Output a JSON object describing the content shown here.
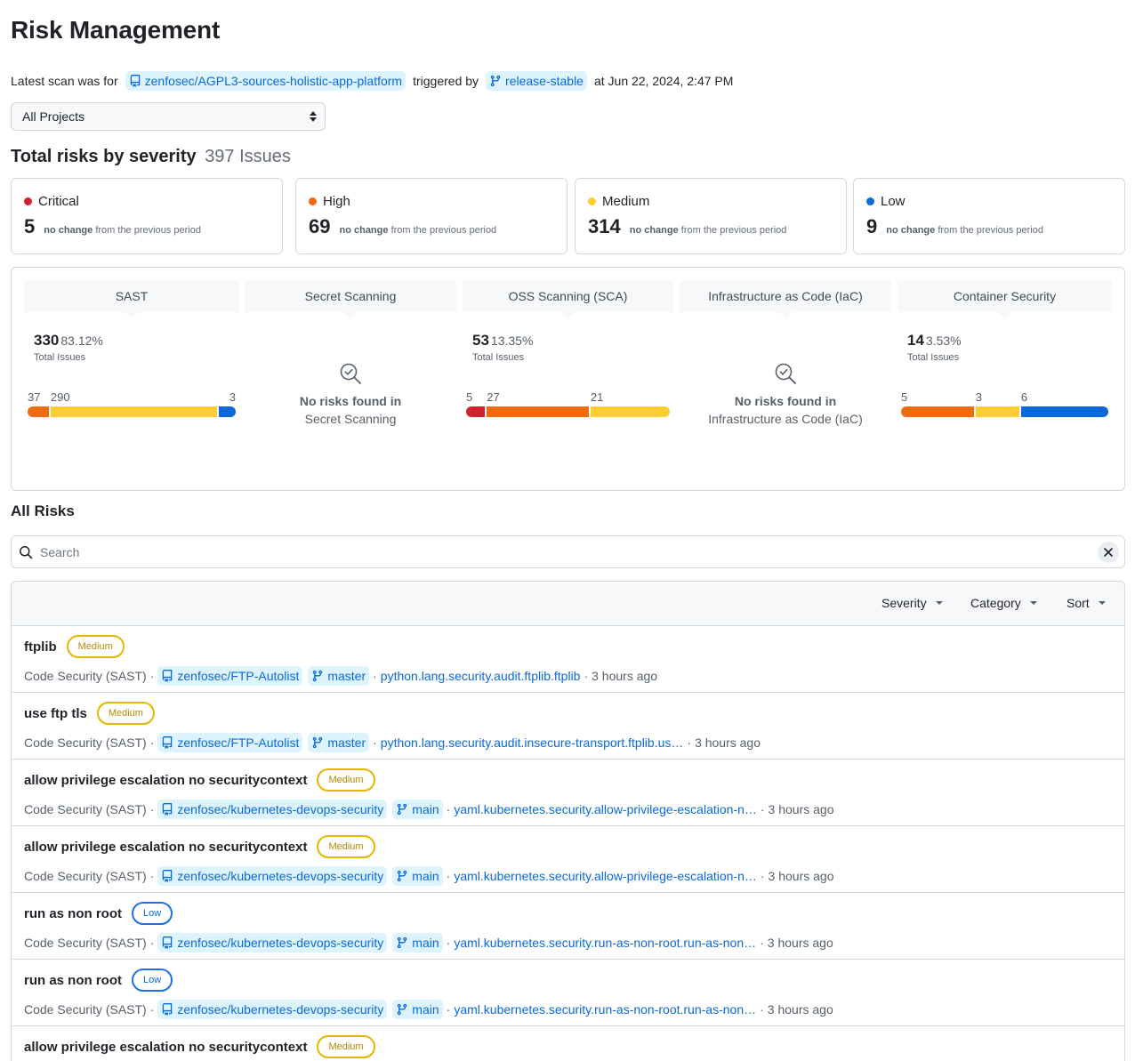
{
  "header": {
    "title": "Risk Management",
    "scan_prefix": "Latest scan was for",
    "repo": "zenfosec/AGPL3-sources-holistic-app-platform",
    "triggered_by": "triggered by",
    "branch": "release-stable",
    "at_text": "at Jun 22, 2024, 2:47 PM"
  },
  "project_select": {
    "value": "All Projects"
  },
  "severity_summary": {
    "title": "Total risks by severity",
    "count": "397 Issues",
    "cards": [
      {
        "label": "Critical",
        "value": "5",
        "change": "no change",
        "suffix": "from the previous period",
        "color": "#cf222e"
      },
      {
        "label": "High",
        "value": "69",
        "change": "no change",
        "suffix": "from the previous period",
        "color": "#f06a0f"
      },
      {
        "label": "Medium",
        "value": "314",
        "change": "no change",
        "suffix": "from the previous period",
        "color": "#fdcd33"
      },
      {
        "label": "Low",
        "value": "9",
        "change": "no change",
        "suffix": "from the previous period",
        "color": "#0969da"
      }
    ]
  },
  "categories": [
    {
      "name": "SAST",
      "total": "330",
      "percent": "83.12%",
      "sub": "Total Issues",
      "segments": [
        {
          "label": "37",
          "value": 37,
          "color": "#f06a0f"
        },
        {
          "label": "290",
          "value": 290,
          "color": "#fdcd33"
        },
        {
          "label": "3",
          "value": 3,
          "color": "#0969da"
        }
      ]
    },
    {
      "name": "Secret Scanning",
      "empty_title": "No risks found in",
      "empty_sub": "Secret Scanning"
    },
    {
      "name": "OSS Scanning (SCA)",
      "total": "53",
      "percent": "13.35%",
      "sub": "Total Issues",
      "segments": [
        {
          "label": "5",
          "value": 5,
          "color": "#cf222e"
        },
        {
          "label": "27",
          "value": 27,
          "color": "#f06a0f"
        },
        {
          "label": "21",
          "value": 21,
          "color": "#fdcd33"
        }
      ]
    },
    {
      "name": "Infrastructure as Code (IaC)",
      "empty_title": "No risks found in",
      "empty_sub": "Infrastructure as Code (IaC)"
    },
    {
      "name": "Container Security",
      "total": "14",
      "percent": "3.53%",
      "sub": "Total Issues",
      "segments": [
        {
          "label": "5",
          "value": 5,
          "color": "#f06a0f"
        },
        {
          "label": "3",
          "value": 3,
          "color": "#fdcd33"
        },
        {
          "label": "6",
          "value": 6,
          "color": "#0969da"
        }
      ]
    }
  ],
  "all_risks": {
    "title": "All Risks",
    "search_placeholder": "Search",
    "filters": {
      "severity": "Severity",
      "category": "Category",
      "sort": "Sort"
    },
    "items": [
      {
        "name": "ftplib",
        "severity": "Medium",
        "category": "Code Security (SAST)",
        "repo": "zenfosec/FTP-Autolist",
        "branch": "master",
        "rule": "python.lang.security.audit.ftplib.ftplib",
        "time": "3 hours ago"
      },
      {
        "name": "use ftp tls",
        "severity": "Medium",
        "category": "Code Security (SAST)",
        "repo": "zenfosec/FTP-Autolist",
        "branch": "master",
        "rule": "python.lang.security.audit.insecure-transport.ftplib.us…",
        "time": "3 hours ago"
      },
      {
        "name": "allow privilege escalation no securitycontext",
        "severity": "Medium",
        "category": "Code Security (SAST)",
        "repo": "zenfosec/kubernetes-devops-security",
        "branch": "main",
        "rule": "yaml.kubernetes.security.allow-privilege-escalation-n…",
        "time": "3 hours ago"
      },
      {
        "name": "allow privilege escalation no securitycontext",
        "severity": "Medium",
        "category": "Code Security (SAST)",
        "repo": "zenfosec/kubernetes-devops-security",
        "branch": "main",
        "rule": "yaml.kubernetes.security.allow-privilege-escalation-n…",
        "time": "3 hours ago"
      },
      {
        "name": "run as non root",
        "severity": "Low",
        "category": "Code Security (SAST)",
        "repo": "zenfosec/kubernetes-devops-security",
        "branch": "main",
        "rule": "yaml.kubernetes.security.run-as-non-root.run-as-non…",
        "time": "3 hours ago"
      },
      {
        "name": "run as non root",
        "severity": "Low",
        "category": "Code Security (SAST)",
        "repo": "zenfosec/kubernetes-devops-security",
        "branch": "main",
        "rule": "yaml.kubernetes.security.run-as-non-root.run-as-non…",
        "time": "3 hours ago"
      },
      {
        "name": "allow privilege escalation no securitycontext",
        "severity": "Medium",
        "category": "",
        "repo": "",
        "branch": "",
        "rule": "",
        "time": ""
      }
    ]
  },
  "icons": {
    "repo": "repo-icon",
    "branch": "git-branch-icon",
    "search": "search-icon",
    "clear": "close-icon",
    "empty": "magnifier-check-icon"
  }
}
